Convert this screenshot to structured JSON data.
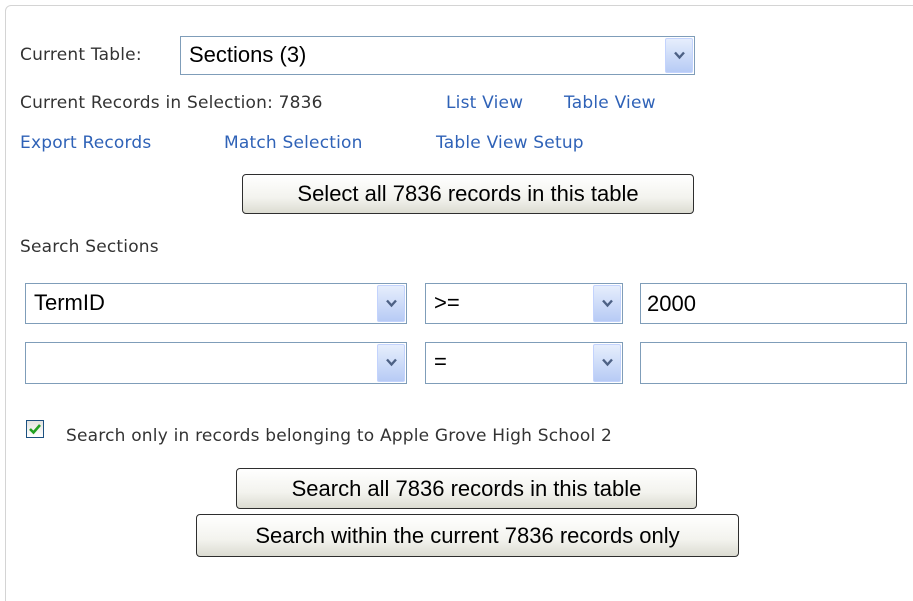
{
  "current_table": {
    "label": "Current Table:",
    "selected": "Sections (3)"
  },
  "selection": {
    "records_label": "Current Records in Selection: 7836",
    "list_view": "List View",
    "table_view": "Table View"
  },
  "actions": {
    "export_records": "Export Records",
    "match_selection": "Match Selection",
    "table_view_setup": "Table View Setup"
  },
  "select_all_button": "Select all 7836 records in this table",
  "search": {
    "heading": "Search Sections",
    "rows": [
      {
        "field": "TermID",
        "operator": ">=",
        "value": "2000"
      },
      {
        "field": "",
        "operator": "=",
        "value": ""
      }
    ],
    "school_only_checked": true,
    "school_only_label": "Search only in records belonging to Apple Grove High School 2",
    "search_all_button": "Search all 7836 records in this table",
    "search_within_button": "Search within the current 7836 records only"
  },
  "icons": {
    "dropdown": "chevron-down-icon",
    "checkbox": "checkmark-icon"
  },
  "colors": {
    "link": "#2f62b7",
    "checkmark": "#21a121",
    "border": "#7f9db9"
  }
}
